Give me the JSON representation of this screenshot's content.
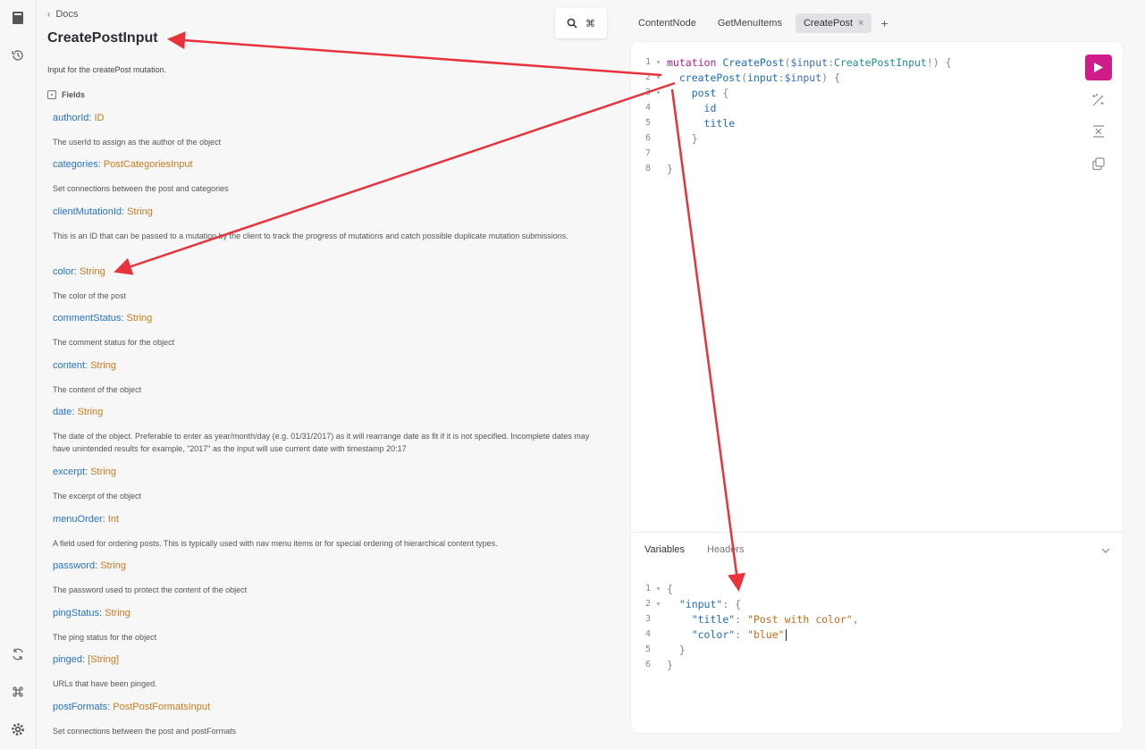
{
  "rail": {
    "icons": [
      "docs-icon",
      "history-icon",
      "refresh-icon",
      "command-icon",
      "settings-icon"
    ]
  },
  "docs": {
    "back_label": "Docs",
    "title": "CreatePostInput",
    "search_shortcut": "⌘",
    "description": "Input for the createPost mutation.",
    "fields_header": "Fields",
    "fields": [
      {
        "name": "authorId",
        "type": "ID",
        "desc": "The userId to assign as the author of the object"
      },
      {
        "name": "categories",
        "type": "PostCategoriesInput",
        "desc": "Set connections between the post and categories"
      },
      {
        "name": "clientMutationId",
        "type": "String",
        "desc": "This is an ID that can be passed to a mutation by the client to track the progress of mutations and catch possible duplicate mutation submissions."
      },
      {
        "name": "color",
        "type": "String",
        "desc": "The color of the post"
      },
      {
        "name": "commentStatus",
        "type": "String",
        "desc": "The comment status for the object"
      },
      {
        "name": "content",
        "type": "String",
        "desc": "The content of the object"
      },
      {
        "name": "date",
        "type": "String",
        "desc": "The date of the object. Preferable to enter as year/month/day (e.g. 01/31/2017) as it will rearrange date as fit if it is not specified. Incomplete dates may have unintended results for example, \"2017\" as the input will use current date with timestamp 20:17"
      },
      {
        "name": "excerpt",
        "type": "String",
        "desc": "The excerpt of the object"
      },
      {
        "name": "menuOrder",
        "type": "Int",
        "desc": "A field used for ordering posts. This is typically used with nav menu items or for special ordering of hierarchical content types."
      },
      {
        "name": "password",
        "type": "String",
        "desc": "The password used to protect the content of the object"
      },
      {
        "name": "pingStatus",
        "type": "String",
        "desc": "The ping status for the object"
      },
      {
        "name": "pinged",
        "type": "[String]",
        "desc": "URLs that have been pinged."
      },
      {
        "name": "postFormats",
        "type": "PostPostFormatsInput",
        "desc": "Set connections between the post and postFormats"
      }
    ]
  },
  "tabs": [
    {
      "label": "ContentNode",
      "active": false
    },
    {
      "label": "GetMenuItems",
      "active": false
    },
    {
      "label": "CreatePost",
      "active": true
    }
  ],
  "tab_close": "×",
  "tab_add": "+",
  "query": {
    "line_numbers": [
      "1",
      "2",
      "3",
      "4",
      "5",
      "6",
      "7",
      "8"
    ],
    "fold_markers": [
      "▾",
      "▾",
      "▾",
      "",
      "",
      "",
      "",
      ""
    ]
  },
  "variables_panel": {
    "tabs": [
      "Variables",
      "Headers"
    ],
    "line_numbers": [
      "1",
      "2",
      "3",
      "4",
      "5",
      "6"
    ],
    "fold_markers": [
      "▾",
      "▾",
      "",
      "",
      "",
      ""
    ]
  },
  "colors": {
    "run_button": "#d01b8b",
    "annotation_arrow": "#e8323c",
    "field_name": "#2672c9",
    "field_type": "#cc7a1c"
  }
}
